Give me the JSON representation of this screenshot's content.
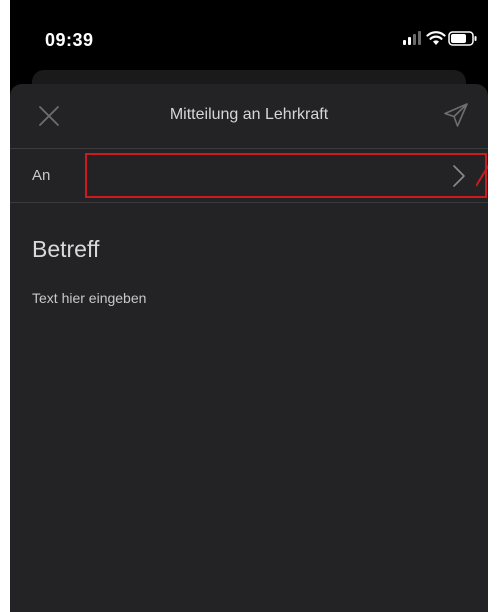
{
  "status_bar": {
    "time": "09:39",
    "icons": [
      "signal-icon",
      "wifi-icon",
      "battery-icon"
    ]
  },
  "compose": {
    "title": "Mitteilung an Lehrkraft",
    "close_icon": "close-icon",
    "send_icon": "send-icon",
    "recipient_label": "An",
    "recipient_value": "",
    "subject_placeholder": "Betreff",
    "body_placeholder": "Text hier eingeben"
  },
  "annotation": {
    "highlight_color": "#cc1a1f"
  },
  "colors": {
    "background": "#000000",
    "sheet": "#232325",
    "text_primary": "#d9d9d9",
    "divider": "#3b3b3e"
  }
}
